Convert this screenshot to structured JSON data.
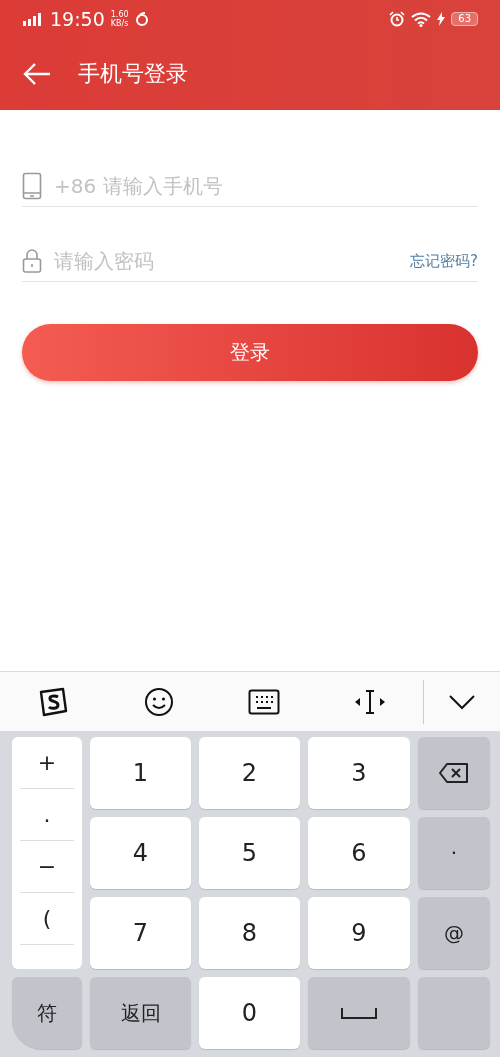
{
  "status_bar": {
    "time": "19:50",
    "speed_value": "1.60",
    "speed_unit": "KB/s",
    "battery": "63"
  },
  "header": {
    "title": "手机号登录"
  },
  "form": {
    "phone": {
      "placeholder": "+86 请输入手机号"
    },
    "password": {
      "placeholder": "请输入密码"
    },
    "forgot_link": "忘记密码?",
    "login_button": "登录"
  },
  "keyboard": {
    "symbols": [
      "+",
      ".",
      "−",
      "("
    ],
    "keys": [
      {
        "kind": "digit",
        "label": "1"
      },
      {
        "kind": "digit",
        "label": "2"
      },
      {
        "kind": "digit",
        "label": "3"
      },
      {
        "kind": "backspace"
      },
      {
        "kind": "digit",
        "label": "4"
      },
      {
        "kind": "digit",
        "label": "5"
      },
      {
        "kind": "digit",
        "label": "6"
      },
      {
        "kind": "function",
        "label": "·"
      },
      {
        "kind": "digit",
        "label": "7"
      },
      {
        "kind": "digit",
        "label": "8"
      },
      {
        "kind": "digit",
        "label": "9"
      },
      {
        "kind": "function",
        "label": "@"
      }
    ],
    "bottom_keys": [
      {
        "kind": "function",
        "label": "符"
      },
      {
        "kind": "function",
        "label": "返回"
      },
      {
        "kind": "digit",
        "label": "0"
      },
      {
        "kind": "space"
      },
      {
        "kind": "blank"
      }
    ]
  }
}
